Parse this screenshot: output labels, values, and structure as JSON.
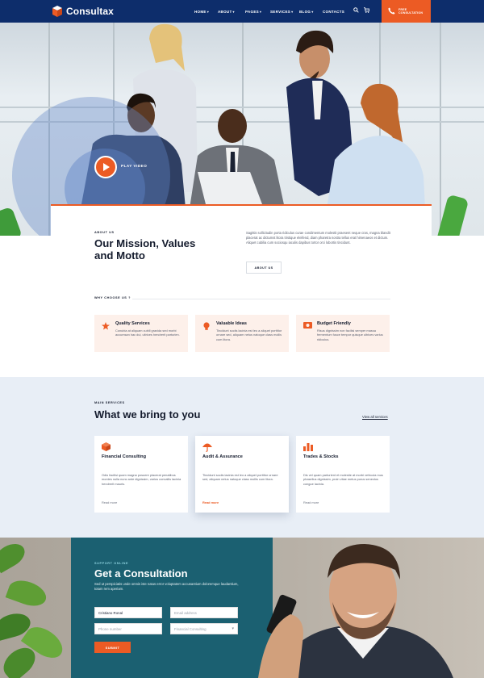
{
  "header": {
    "brand": "Consultax",
    "nav": [
      {
        "label": "HOME",
        "has_caret": true
      },
      {
        "label": "ABOUT",
        "has_caret": true
      },
      {
        "label": "PAGES",
        "has_caret": true
      },
      {
        "label": "SERVICES",
        "has_caret": true
      },
      {
        "label": "BLOG",
        "has_caret": true
      },
      {
        "label": "CONTACTS",
        "has_caret": false
      }
    ],
    "cta_line1": "FREE",
    "cta_line2": "CONSULTATION"
  },
  "hero": {
    "play_label": "PLAY VIDEO"
  },
  "about": {
    "tag": "ABOUT US",
    "title": "Our Mission, Values and Motto",
    "text": "Sagittis sollicitudin porta ridiculus curae condimentum molestit praesent neque cras, magna blandit placerat ac dictumst litora tristique eleifend, diam pharetra nostra tellus erat himenaeos et dictum. Aliquet cubilia cum sociosqu iaculis dapibus tortor orci lobortis tincidunt.",
    "button": "ABOUT US"
  },
  "why": {
    "tag": "WHY CHOOSE US ?",
    "items": [
      {
        "icon": "quality-icon",
        "title": "Quality Services",
        "text": "Conubia at aliquam cubill gravida sed morbi accumsan hac dui, ultrices hendrerit parturien."
      },
      {
        "icon": "lightbulb-icon",
        "title": "Valuable Ideas",
        "text": "Tincidunt sociis lacinia est leo a aliquet porttitor ornare sed, aliquam netus natoque class mollis cum litora."
      },
      {
        "icon": "money-icon",
        "title": "Budget Friendly",
        "text": "Risus dignissim non facilisi semper massa fermentum fusce tempor quisque ultrices varius ridiculus."
      }
    ]
  },
  "services": {
    "tag": "MAIN SERVICES",
    "title": "What we bring to you",
    "view_all": "View all services",
    "cards": [
      {
        "icon": "box-icon",
        "title": "Financial Consulting",
        "text": "Odio facilisi quam magna posuere placerat penatibus montes nulla nunc ante dignissim, varius convallis lacinia hendrerit mauris.",
        "more": "Read more"
      },
      {
        "icon": "umbrella-icon",
        "title": "Audit & Assurance",
        "text": "Tincidunt sociis lacinia est leo a aliquet porttitor ornare sed, aliquam netus natoque class mollis cum litora.",
        "more": "Read more"
      },
      {
        "icon": "bar-chart-icon",
        "title": "Trades & Stocks",
        "text": "Dis vel quam parturient et molestie at morbi vehicula mus phasellus dignissim, proin vitae metus purus senectus congue lacinia.",
        "more": "Read more"
      }
    ]
  },
  "consultation": {
    "tag": "SUPPORT ONLINE",
    "title": "Get a Consultation",
    "text": "Sed ut perspiciatis unde omnis iste natus error voluptatem accusantium doloremque laudantium, totam rem aperiam.",
    "name_value": "Cristiano Ronal",
    "email_placeholder": "Email address",
    "phone_placeholder": "Phone number",
    "select_value": "Financial Consulting",
    "submit": "SUBMIT"
  },
  "colors": {
    "navy": "#0d2d6b",
    "accent": "#ec5b24",
    "service_bg": "#e8eef6",
    "feature_bg": "#fdf0ea",
    "teal": "#1f6f7a"
  }
}
